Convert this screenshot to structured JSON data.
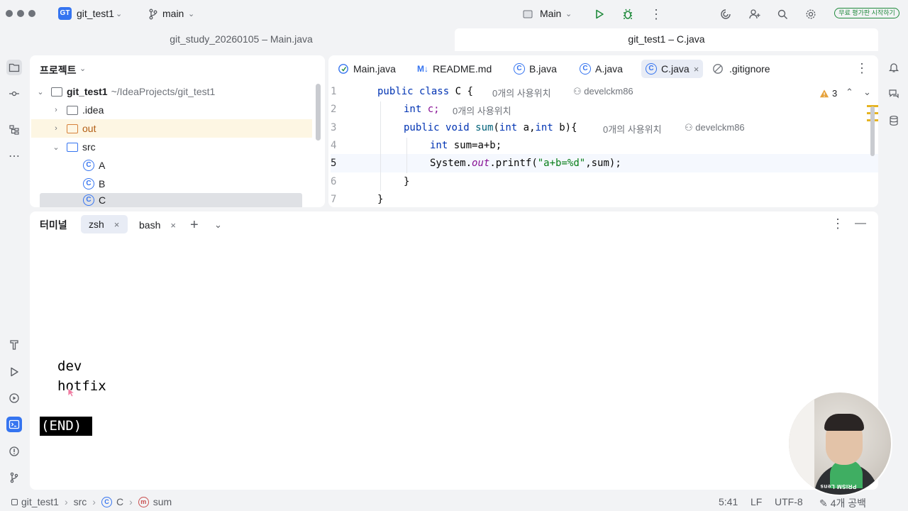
{
  "titlebar": {
    "project_badge": "GT",
    "project_name": "git_test1",
    "branch": "main",
    "run_config": "Main",
    "trial_button": "무료 평가판 시작하기"
  },
  "window_tabs": [
    {
      "label": "git_study_20260105 – Main.java",
      "active": false
    },
    {
      "label": "git_test1 – C.java",
      "active": true
    }
  ],
  "project_panel": {
    "title": "프로젝트",
    "root_name": "git_test1",
    "root_path": "~/IdeaProjects/git_test1",
    "items": [
      {
        "label": ".idea",
        "kind": "folder"
      },
      {
        "label": "out",
        "kind": "folder-excluded"
      },
      {
        "label": "src",
        "kind": "folder-source"
      },
      {
        "label": "A",
        "kind": "class"
      },
      {
        "label": "B",
        "kind": "class"
      },
      {
        "label": "C",
        "kind": "class"
      }
    ]
  },
  "editor": {
    "tabs": [
      {
        "label": "Main.java",
        "icon": "main-class-icon"
      },
      {
        "label": "README.md",
        "icon": "markdown-icon"
      },
      {
        "label": "B.java",
        "icon": "class-icon"
      },
      {
        "label": "A.java",
        "icon": "class-icon"
      },
      {
        "label": "C.java",
        "icon": "class-icon",
        "active": true
      },
      {
        "label": ".gitignore",
        "icon": "ignore-icon"
      }
    ],
    "warnings_count": "3",
    "line_numbers": [
      "1",
      "2",
      "3",
      "4",
      "5",
      "6",
      "7"
    ],
    "code": {
      "l1_kw1": "public",
      "l1_kw2": "class",
      "l1_name": "C",
      "l1_brace": "{",
      "l1_usages": "0개의 사용위치",
      "l1_author": "develckm86",
      "l2_kw": "int",
      "l2_rest": "c;",
      "l2_usages": "0개의 사용위치",
      "l3_kw1": "public",
      "l3_kw2": "void",
      "l3_fn": "sum",
      "l3_p1": "(",
      "l3_kw3": "int",
      "l3_p2": "a,",
      "l3_kw4": "int",
      "l3_p3": "b){",
      "l3_usages": "0개의 사용위치",
      "l3_author": "develckm86",
      "l4_kw": "int",
      "l4_rest": "sum=a+b;",
      "l5_a": "System.",
      "l5_fld": "out",
      "l5_b": ".printf(",
      "l5_str": "\"a+b=%d\"",
      "l5_c": ",sum);",
      "l6": "}",
      "l7": "}"
    }
  },
  "terminal": {
    "title": "터미널",
    "tabs": [
      {
        "label": "zsh",
        "active": true
      },
      {
        "label": "bash",
        "active": false
      }
    ],
    "output_lines": [
      "dev",
      "hotfix"
    ],
    "end_marker": "(END)"
  },
  "statusbar": {
    "breadcrumb": [
      "git_test1",
      "src",
      "C",
      "sum"
    ],
    "position": "5:41",
    "line_sep": "LF",
    "encoding": "UTF-8",
    "indent": "4개 공백"
  },
  "webcam": {
    "label": "PRISM Lens"
  },
  "colors": {
    "accent": "#3574f0",
    "keyword": "#0033b3",
    "string": "#067d17",
    "run_green": "#208a3c"
  }
}
